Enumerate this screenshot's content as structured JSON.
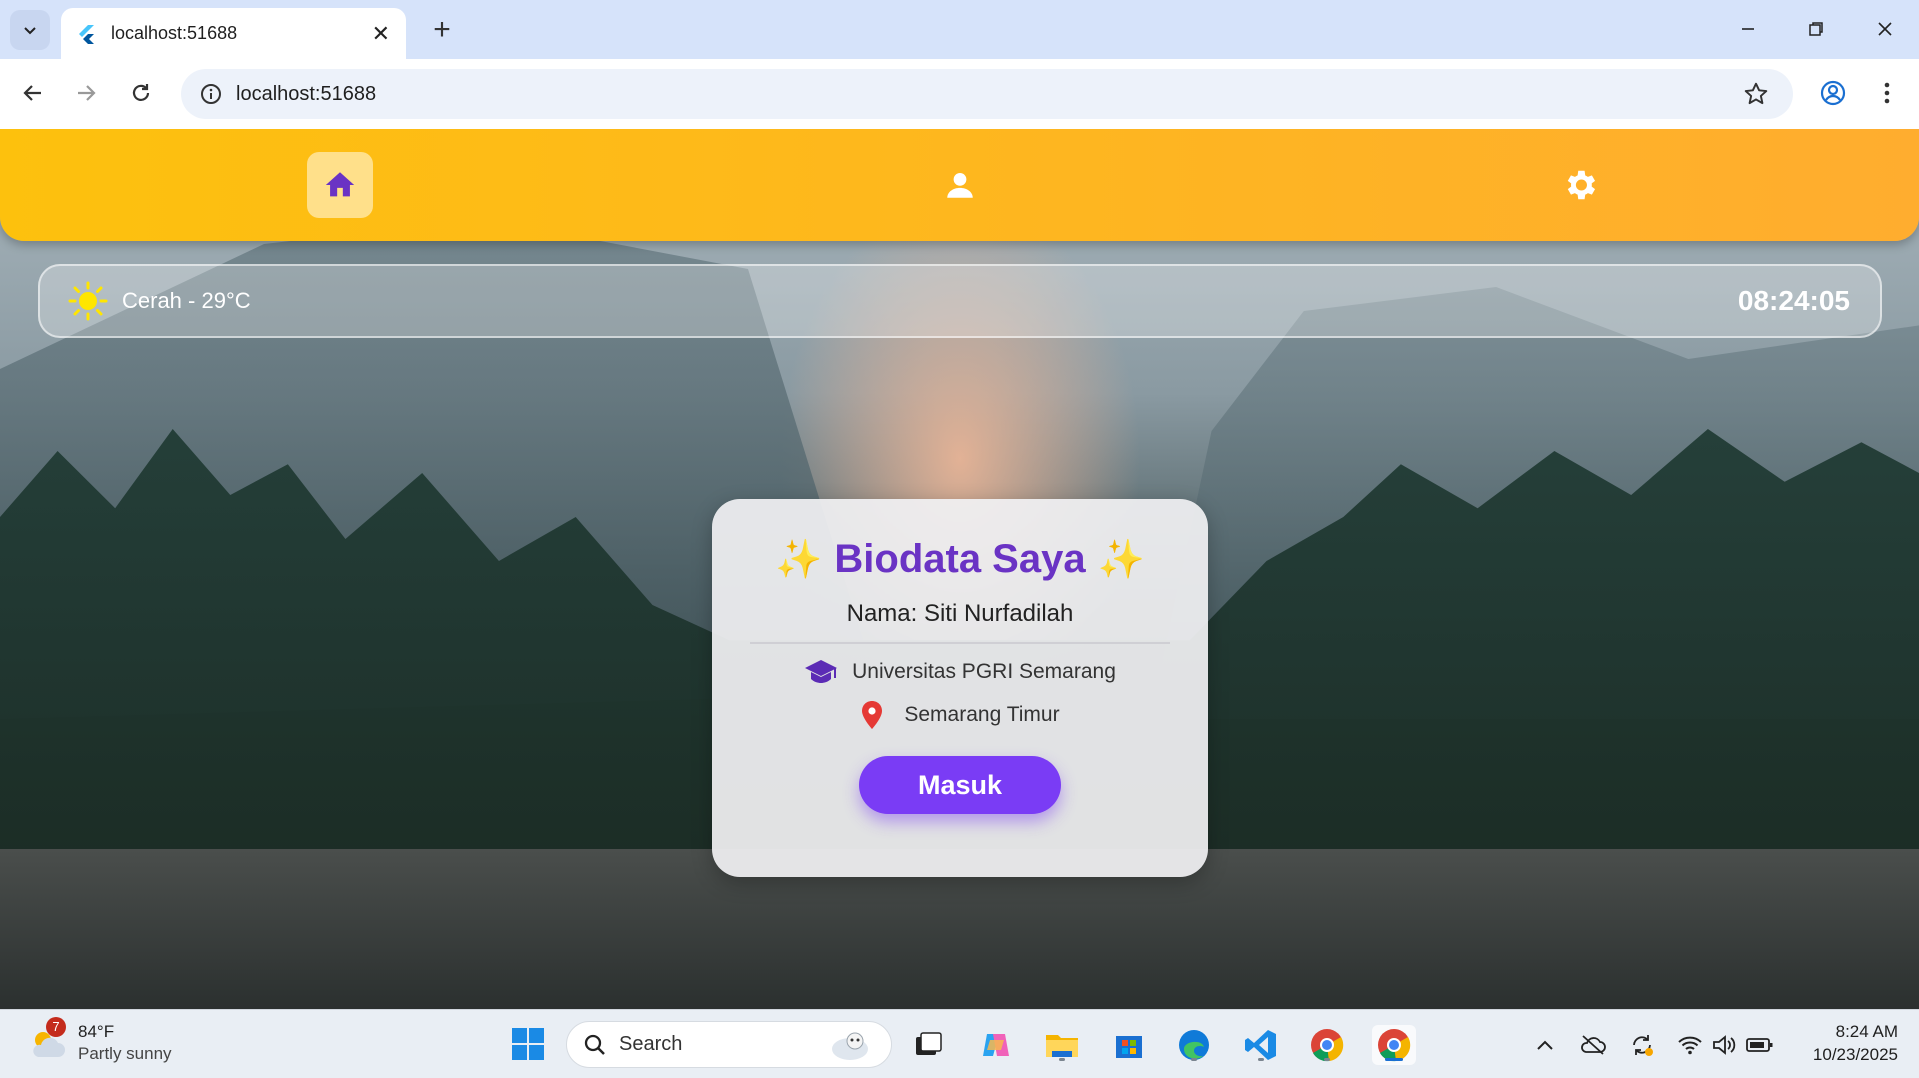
{
  "browser": {
    "tab_title": "localhost:51688",
    "url": "localhost:51688"
  },
  "app": {
    "nav": [
      "home",
      "profile",
      "settings"
    ],
    "active_nav": "home",
    "weather_text": "Cerah - 29°C",
    "clock": "08:24:05",
    "card": {
      "heading": "Biodata Saya",
      "spark": "✨",
      "name_line": "Nama: Siti Nurfadilah",
      "university": "Universitas PGRI Semarang",
      "location": "Semarang Timur",
      "button_label": "Masuk"
    },
    "colors": {
      "appbar": "#fdc10d",
      "accent_purple": "#7a3cf5",
      "heading_purple": "#6a33c4"
    }
  },
  "taskbar": {
    "weather_temp": "84°F",
    "weather_desc": "Partly sunny",
    "weather_badge": "7",
    "search_label": "Search",
    "time": "8:24 AM",
    "date": "10/23/2025"
  }
}
